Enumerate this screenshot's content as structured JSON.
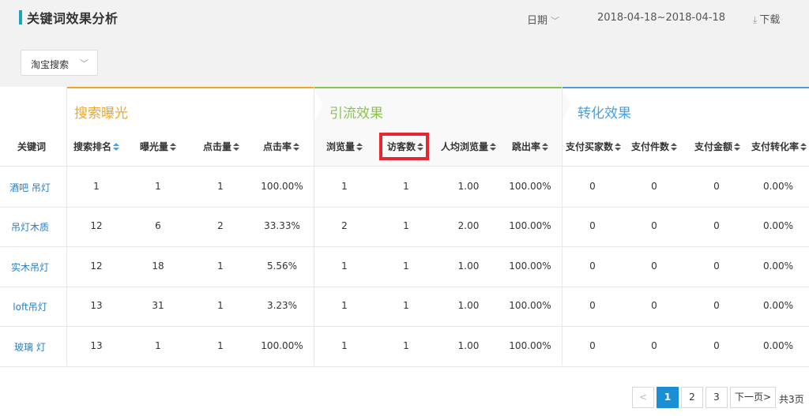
{
  "header": {
    "title": "关键词效果分析",
    "date_label": "日期",
    "date_range": "2018-04-18~2018-04-18",
    "download_label": "下载"
  },
  "filter": {
    "source_selected": "淘宝搜索"
  },
  "sections": [
    {
      "label": "搜索曝光",
      "color": "#f5a623"
    },
    {
      "label": "引流效果",
      "color": "#8bc34a"
    },
    {
      "label": "转化效果",
      "color": "#4a9fe0"
    }
  ],
  "columns": [
    "关键词",
    "搜索排名",
    "曝光量",
    "点击量",
    "点击率",
    "浏览量",
    "访客数",
    "人均浏览量",
    "跳出率",
    "支付买家数",
    "支付件数",
    "支付金额",
    "支付转化率"
  ],
  "rows": [
    [
      "酒吧 吊灯",
      "1",
      "1",
      "1",
      "100.00%",
      "1",
      "1",
      "1.00",
      "100.00%",
      "0",
      "0",
      "0",
      "0.00%"
    ],
    [
      "吊灯木质",
      "12",
      "6",
      "2",
      "33.33%",
      "2",
      "1",
      "2.00",
      "100.00%",
      "0",
      "0",
      "0",
      "0.00%"
    ],
    [
      "实木吊灯",
      "12",
      "18",
      "1",
      "5.56%",
      "1",
      "1",
      "1.00",
      "100.00%",
      "0",
      "0",
      "0",
      "0.00%"
    ],
    [
      "loft吊灯",
      "13",
      "31",
      "1",
      "3.23%",
      "1",
      "1",
      "1.00",
      "100.00%",
      "0",
      "0",
      "0",
      "0.00%"
    ],
    [
      "玻璃 灯",
      "13",
      "1",
      "1",
      "100.00%",
      "1",
      "1",
      "1.00",
      "100.00%",
      "0",
      "0",
      "0",
      "0.00%"
    ]
  ],
  "pagination": {
    "prev": "<",
    "pages": [
      "1",
      "2",
      "3"
    ],
    "current": "1",
    "next": "下一页>",
    "total": "共3页"
  }
}
